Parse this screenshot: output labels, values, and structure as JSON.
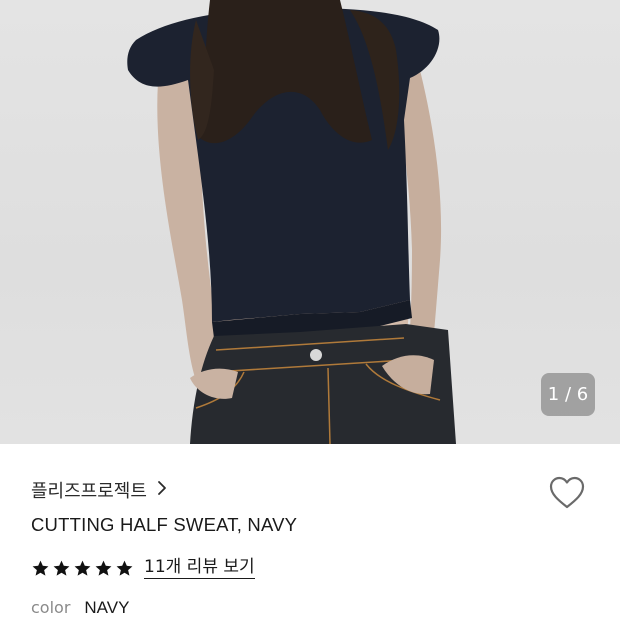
{
  "gallery": {
    "current_page": "1",
    "separator": "/",
    "total_pages": "6",
    "page_indicator": "1 / 6"
  },
  "product": {
    "brand": "플리즈프로젝트",
    "title": "CUTTING HALF SWEAT, NAVY",
    "rating_stars": 5,
    "review_link": "11개 리뷰 보기",
    "color_label": "color",
    "color_value": "NAVY"
  },
  "icons": {
    "brand_chevron": "chevron-right-icon",
    "wish": "heart-outline-icon",
    "star": "star-filled-icon"
  },
  "colors": {
    "background": "#ffffff",
    "text": "#1a1a1a",
    "muted": "#8a8a8a",
    "photo_bg": "#e0e0e0"
  }
}
